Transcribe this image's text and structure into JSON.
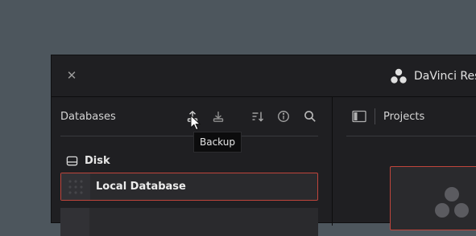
{
  "window": {
    "close_icon": "close-icon",
    "app_title": "DaVinci Resol",
    "brand_icon": "davinci-resolve-logo"
  },
  "databases": {
    "title": "Databases",
    "toolbar": {
      "backup_icon": "upload-icon",
      "restore_icon": "download-icon",
      "sort_icon": "sort-icon",
      "info_icon": "info-icon",
      "search_icon": "search-icon"
    },
    "group_label": "Disk",
    "items": [
      {
        "name": "Local Database",
        "selected": true
      }
    ]
  },
  "projects": {
    "title": "Projects"
  },
  "tooltip": {
    "text": "Backup"
  },
  "colors": {
    "background": "#4d565d",
    "window": "#1f1f22",
    "selection_border": "#c0453c"
  }
}
